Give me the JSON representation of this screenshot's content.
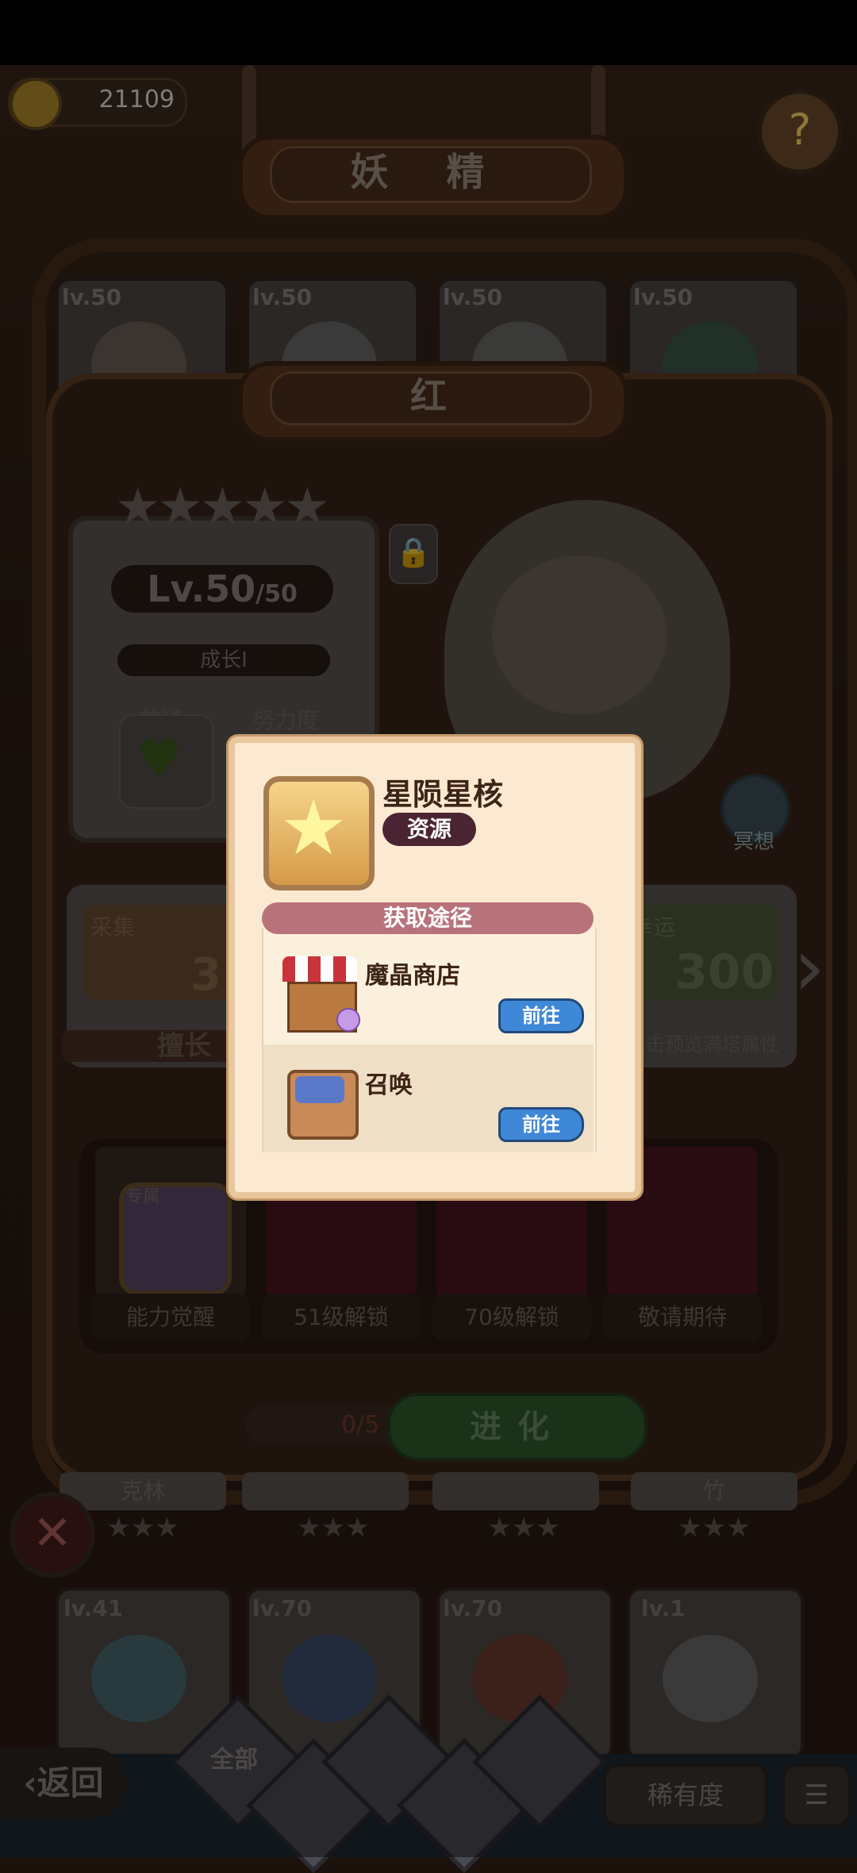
{
  "resources": {
    "coins": "21109"
  },
  "page": {
    "title": "妖 精",
    "attribute": "红"
  },
  "top_fairies": [
    {
      "level": "lv.50"
    },
    {
      "level": "lv.50"
    },
    {
      "level": "lv.50"
    },
    {
      "level": "lv.50"
    }
  ],
  "info": {
    "level_main": "Lv.50",
    "level_max": "/50",
    "growth": "成长I",
    "normal_label": "普通",
    "effort_label": "努力度",
    "meditate_label": "冥想"
  },
  "stats": {
    "left_label": "采集",
    "left_value": "3",
    "right_label": "幸运",
    "right_value": "300",
    "specialty_label": "擅长",
    "preview_text": "点击预览满塔属性"
  },
  "skills": {
    "exclusive_tag": "专属",
    "awaken": "能力觉醒",
    "slot2": "51级解锁",
    "slot3": "70级解锁",
    "slot4": "敬请期待"
  },
  "evolve": {
    "progress": "0/5",
    "button": "进化"
  },
  "bottom_names": [
    "克林",
    "",
    "",
    "竹"
  ],
  "bottom_fairies": [
    {
      "level": "lv.41"
    },
    {
      "level": "lv.70"
    },
    {
      "level": "lv.70"
    },
    {
      "level": "lv.1"
    }
  ],
  "bottom_bar": {
    "back": "返回",
    "all": "全部",
    "rarity": "稀有度"
  },
  "popup": {
    "item_name": "星陨星核",
    "item_tag": "资源",
    "sources_header": "获取途径",
    "sources": [
      {
        "name": "魔晶商店",
        "button": "前往"
      },
      {
        "name": "召唤",
        "button": "前往"
      }
    ]
  }
}
